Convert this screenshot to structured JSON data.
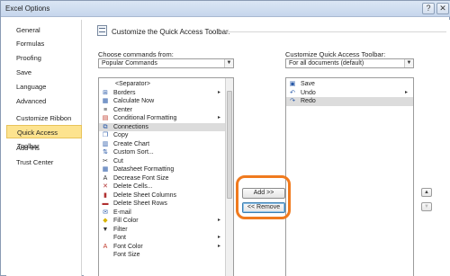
{
  "window": {
    "title": "Excel Options",
    "help_glyph": "?",
    "close_glyph": "✕"
  },
  "sidebar": {
    "items": [
      {
        "label": "General"
      },
      {
        "label": "Formulas"
      },
      {
        "label": "Proofing"
      },
      {
        "label": "Save"
      },
      {
        "label": "Language"
      },
      {
        "label": "Advanced"
      },
      {
        "label": "Customize Ribbon"
      },
      {
        "label": "Quick Access Toolbar",
        "active": true
      },
      {
        "label": "Add-Ins"
      },
      {
        "label": "Trust Center"
      }
    ]
  },
  "header": {
    "title": "Customize the Quick Access Toolbar."
  },
  "left_panel": {
    "label": "Choose commands from:",
    "dropdown_value": "Popular Commands",
    "commands": [
      {
        "label": "<Separator>",
        "icon": "none"
      },
      {
        "label": "Borders",
        "icon": "borders-icon",
        "submenu": true
      },
      {
        "label": "Calculate Now",
        "icon": "calculate-icon"
      },
      {
        "label": "Center",
        "icon": "center-icon"
      },
      {
        "label": "Conditional Formatting",
        "icon": "conditional-formatting-icon",
        "submenu": true
      },
      {
        "label": "Connections",
        "icon": "connections-icon",
        "selected": true
      },
      {
        "label": "Copy",
        "icon": "copy-icon"
      },
      {
        "label": "Create Chart",
        "icon": "chart-icon"
      },
      {
        "label": "Custom Sort...",
        "icon": "sort-icon"
      },
      {
        "label": "Cut",
        "icon": "cut-icon"
      },
      {
        "label": "Datasheet Formatting",
        "icon": "datasheet-icon"
      },
      {
        "label": "Decrease Font Size",
        "icon": "decrease-font-icon"
      },
      {
        "label": "Delete Cells...",
        "icon": "delete-cells-icon"
      },
      {
        "label": "Delete Sheet Columns",
        "icon": "delete-columns-icon"
      },
      {
        "label": "Delete Sheet Rows",
        "icon": "delete-rows-icon"
      },
      {
        "label": "E-mail",
        "icon": "email-icon"
      },
      {
        "label": "Fill Color",
        "icon": "fill-color-icon",
        "submenu": true
      },
      {
        "label": "Filter",
        "icon": "filter-icon"
      },
      {
        "label": "Font",
        "icon": "font-icon",
        "submenu": true
      },
      {
        "label": "Font Color",
        "icon": "font-color-icon",
        "submenu": true
      },
      {
        "label": "Font Size",
        "icon": "font-size-icon"
      }
    ]
  },
  "right_panel": {
    "label": "Customize Quick Access Toolbar:",
    "dropdown_value": "For all documents (default)",
    "commands": [
      {
        "label": "Save",
        "icon": "save-icon"
      },
      {
        "label": "Undo",
        "icon": "undo-icon",
        "submenu": true
      },
      {
        "label": "Redo",
        "icon": "redo-icon",
        "selected": true
      }
    ]
  },
  "actions": {
    "add_label": "Add >>",
    "remove_label": "<< Remove"
  },
  "glyphs": {
    "dropdown": "▼",
    "submenu": "▸",
    "move_up": "▲",
    "move_down": "▼"
  },
  "colors": {
    "highlight_ring": "#f07a1e",
    "active_nav": "#fde38f"
  }
}
